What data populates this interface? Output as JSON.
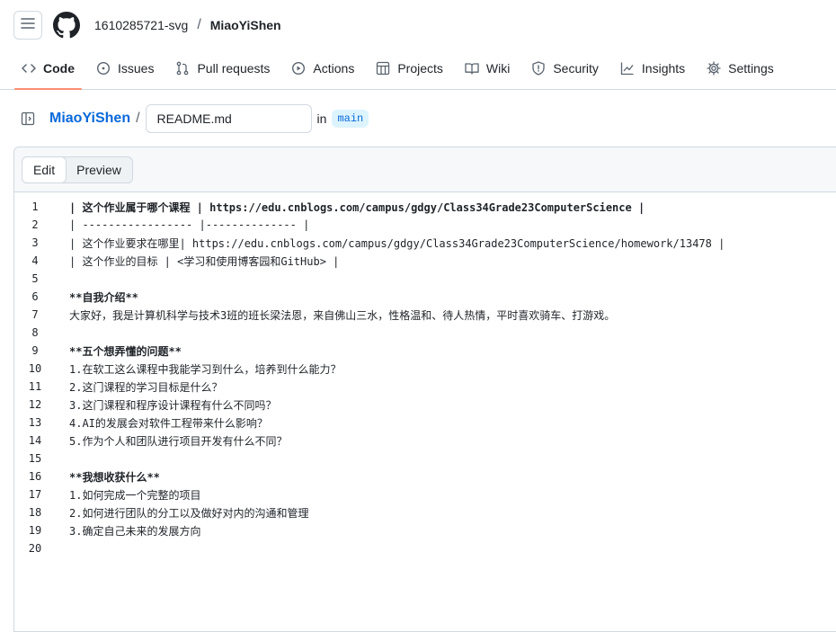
{
  "header": {
    "owner": "1610285721-svg",
    "separator": "/",
    "repo": "MiaoYiShen"
  },
  "nav": [
    {
      "label": "Code",
      "icon": "code-icon",
      "active": true
    },
    {
      "label": "Issues",
      "icon": "issue-icon"
    },
    {
      "label": "Pull requests",
      "icon": "pull-request-icon"
    },
    {
      "label": "Actions",
      "icon": "actions-icon"
    },
    {
      "label": "Projects",
      "icon": "projects-icon"
    },
    {
      "label": "Wiki",
      "icon": "wiki-icon"
    },
    {
      "label": "Security",
      "icon": "shield-icon"
    },
    {
      "label": "Insights",
      "icon": "graph-icon"
    },
    {
      "label": "Settings",
      "icon": "gear-icon"
    }
  ],
  "path": {
    "repo": "MiaoYiShen",
    "slash": "/",
    "filename": "README.md",
    "in_label": "in",
    "branch": "main"
  },
  "editor": {
    "tab_edit": "Edit",
    "tab_preview": "Preview",
    "lines": [
      {
        "n": "1",
        "t": "| 这个作业属于哪个课程 | https://edu.cnblogs.com/campus/gdgy/Class34Grade23ComputerScience |",
        "bold": true
      },
      {
        "n": "2",
        "t": "| ----------------- |-------------- |"
      },
      {
        "n": "3",
        "t": "| 这个作业要求在哪里| https://edu.cnblogs.com/campus/gdgy/Class34Grade23ComputerScience/homework/13478 |"
      },
      {
        "n": "4",
        "t": "| 这个作业的目标 | <学习和使用博客园和GitHub> |"
      },
      {
        "n": "5",
        "t": ""
      },
      {
        "n": "6",
        "t": "**自我介绍**",
        "bold": true
      },
      {
        "n": "7",
        "t": "大家好，我是计算机科学与技术3班的班长梁法恩，来自佛山三水，性格温和、待人热情，平时喜欢骑车、打游戏。"
      },
      {
        "n": "8",
        "t": ""
      },
      {
        "n": "9",
        "t": "**五个想弄懂的问题**",
        "bold": true
      },
      {
        "n": "10",
        "t": "1.在软工这么课程中我能学习到什么，培养到什么能力？"
      },
      {
        "n": "11",
        "t": "2.这门课程的学习目标是什么？"
      },
      {
        "n": "12",
        "t": "3.这门课程和程序设计课程有什么不同吗？"
      },
      {
        "n": "13",
        "t": "4.AI的发展会对软件工程带来什么影响？"
      },
      {
        "n": "14",
        "t": "5.作为个人和团队进行项目开发有什么不同？"
      },
      {
        "n": "15",
        "t": ""
      },
      {
        "n": "16",
        "t": "**我想收获什么**",
        "bold": true
      },
      {
        "n": "17",
        "t": "1.如何完成一个完整的项目"
      },
      {
        "n": "18",
        "t": "2.如何进行团队的分工以及做好对内的沟通和管理"
      },
      {
        "n": "19",
        "t": "3.确定自己未来的发展方向"
      },
      {
        "n": "20",
        "t": ""
      }
    ]
  }
}
